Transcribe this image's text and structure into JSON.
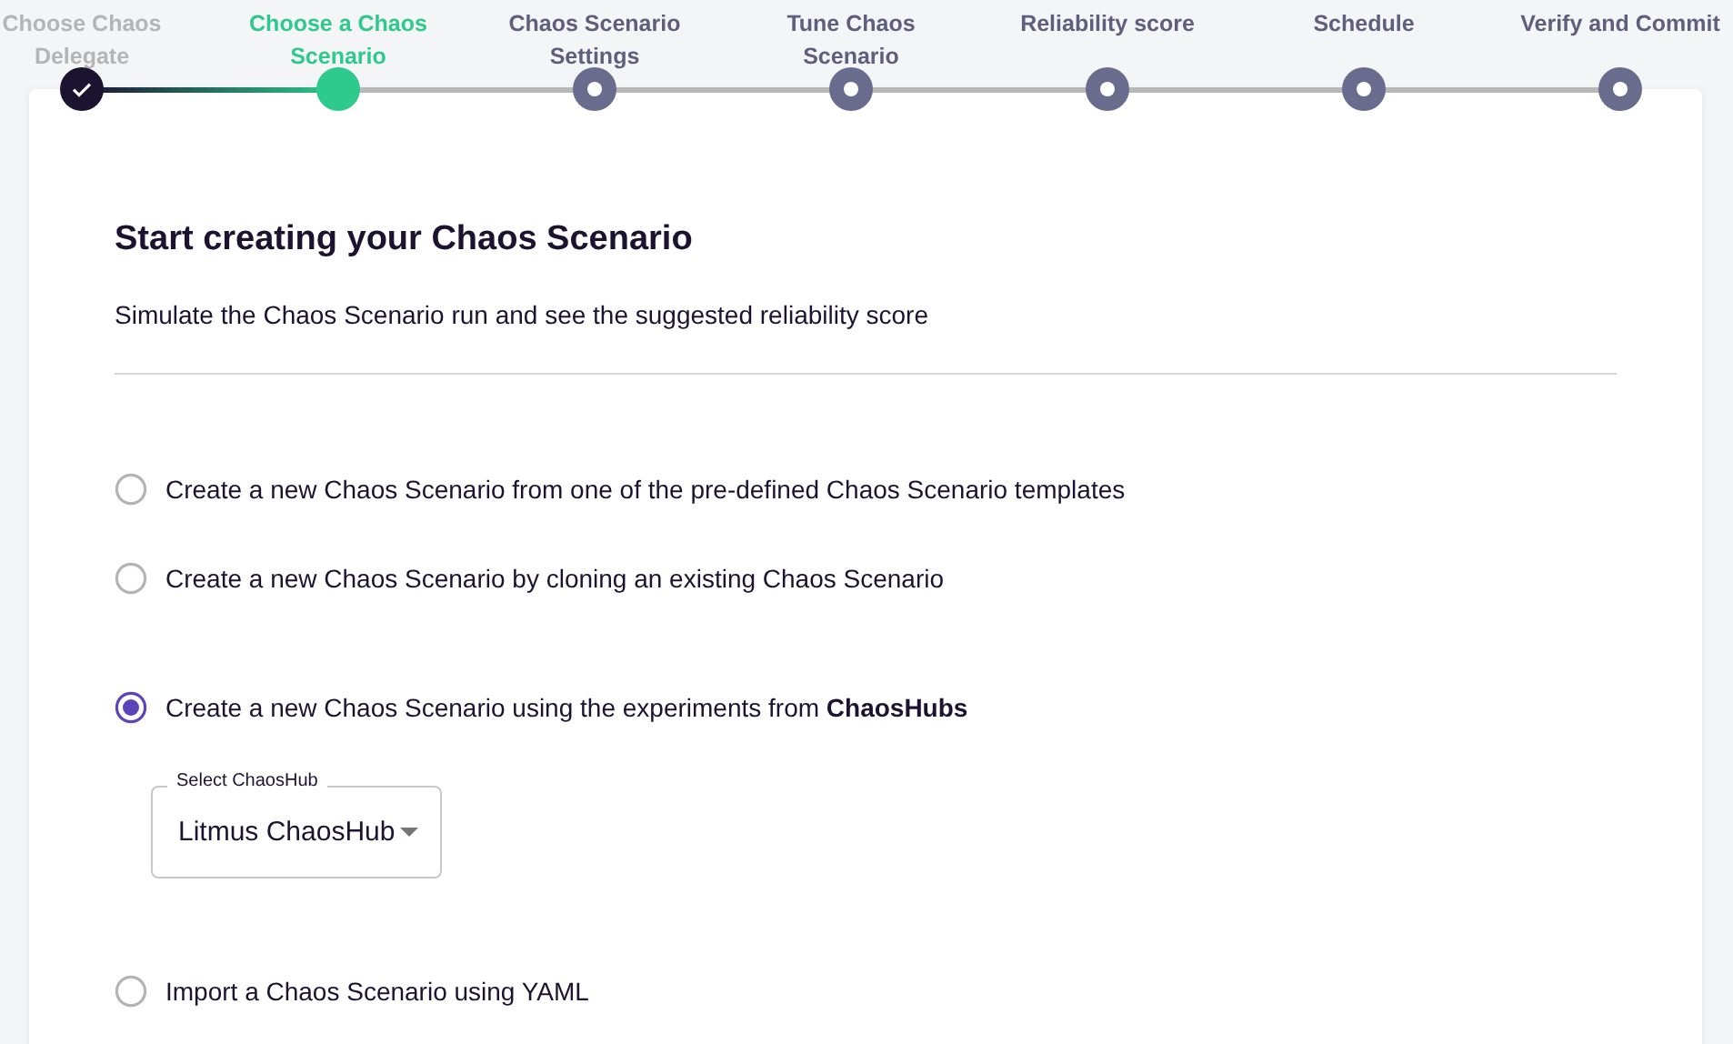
{
  "stepper": [
    {
      "label": "Choose Chaos Delegate",
      "completed": true,
      "selected": false
    },
    {
      "label": "Choose a Chaos Scenario",
      "completed": false,
      "selected": true
    },
    {
      "label": "Chaos Scenario Settings",
      "completed": false,
      "selected": false
    },
    {
      "label": "Tune Chaos Scenario",
      "completed": false,
      "selected": false
    },
    {
      "label": "Reliability score",
      "completed": false,
      "selected": false
    },
    {
      "label": "Schedule",
      "completed": false,
      "selected": false
    },
    {
      "label": "Verify and Commit",
      "completed": false,
      "selected": false
    }
  ],
  "card": {
    "title": "Start creating your Chaos Scenario",
    "subtitle": "Simulate the Chaos Scenario run and see the suggested reliability score",
    "options": [
      {
        "label": "Create a new Chaos Scenario from one of the pre-defined Chaos Scenario templates",
        "selected": false
      },
      {
        "label": "Create a new Chaos Scenario by cloning an existing Chaos Scenario",
        "selected": false
      },
      {
        "label": "Create a new Chaos Scenario using the experiments from **ChaosHubs**",
        "selected": true,
        "select": {
          "label": "Select ChaosHub",
          "value": "Litmus ChaosHub"
        }
      },
      {
        "label": "Import a Chaos Scenario using YAML",
        "selected": false
      }
    ]
  }
}
